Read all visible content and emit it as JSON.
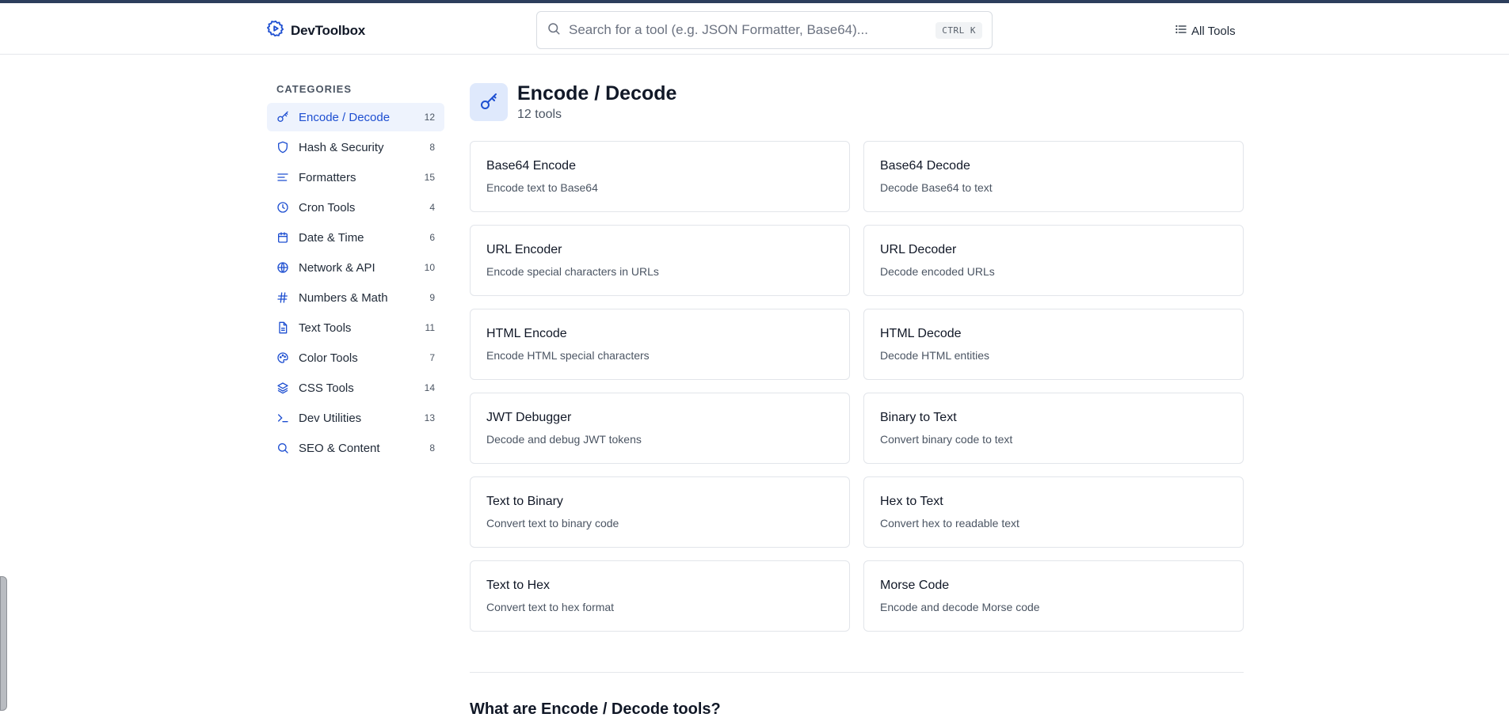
{
  "app": {
    "name": "DevToolbox"
  },
  "search": {
    "placeholder": "Search for a tool (e.g. JSON Formatter, Base64)...",
    "shortcut": "CTRL K"
  },
  "nav": {
    "all_tools": "All Tools"
  },
  "sidebar": {
    "title": "CATEGORIES",
    "items": [
      {
        "label": "Encode / Decode",
        "count": "12",
        "icon": "key-icon",
        "active": true
      },
      {
        "label": "Hash & Security",
        "count": "8",
        "icon": "shield-icon"
      },
      {
        "label": "Formatters",
        "count": "15",
        "icon": "align-left-icon"
      },
      {
        "label": "Cron Tools",
        "count": "4",
        "icon": "clock-icon"
      },
      {
        "label": "Date & Time",
        "count": "6",
        "icon": "calendar-icon"
      },
      {
        "label": "Network & API",
        "count": "10",
        "icon": "globe-icon"
      },
      {
        "label": "Numbers & Math",
        "count": "9",
        "icon": "hash-icon"
      },
      {
        "label": "Text Tools",
        "count": "11",
        "icon": "file-text-icon"
      },
      {
        "label": "Color Tools",
        "count": "7",
        "icon": "palette-icon"
      },
      {
        "label": "CSS Tools",
        "count": "14",
        "icon": "layers-icon"
      },
      {
        "label": "Dev Utilities",
        "count": "13",
        "icon": "terminal-icon"
      },
      {
        "label": "SEO & Content",
        "count": "8",
        "icon": "search-icon"
      }
    ]
  },
  "main": {
    "title": "Encode / Decode",
    "subtitle": "12 tools",
    "tools": [
      {
        "title": "Base64 Encode",
        "desc": "Encode text to Base64"
      },
      {
        "title": "Base64 Decode",
        "desc": "Decode Base64 to text"
      },
      {
        "title": "URL Encoder",
        "desc": "Encode special characters in URLs"
      },
      {
        "title": "URL Decoder",
        "desc": "Decode encoded URLs"
      },
      {
        "title": "HTML Encode",
        "desc": "Encode HTML special characters"
      },
      {
        "title": "HTML Decode",
        "desc": "Decode HTML entities"
      },
      {
        "title": "JWT Debugger",
        "desc": "Decode and debug JWT tokens"
      },
      {
        "title": "Binary to Text",
        "desc": "Convert binary code to text"
      },
      {
        "title": "Text to Binary",
        "desc": "Convert text to binary code"
      },
      {
        "title": "Hex to Text",
        "desc": "Convert hex to readable text"
      },
      {
        "title": "Text to Hex",
        "desc": "Convert text to hex format"
      },
      {
        "title": "Morse Code",
        "desc": "Encode and decode Morse code"
      }
    ],
    "about_heading": "What are Encode / Decode tools?"
  },
  "colors": {
    "accent": "#1e4fd1",
    "active_bg": "#eef3fd",
    "icon_bg": "#dfe9fc"
  }
}
